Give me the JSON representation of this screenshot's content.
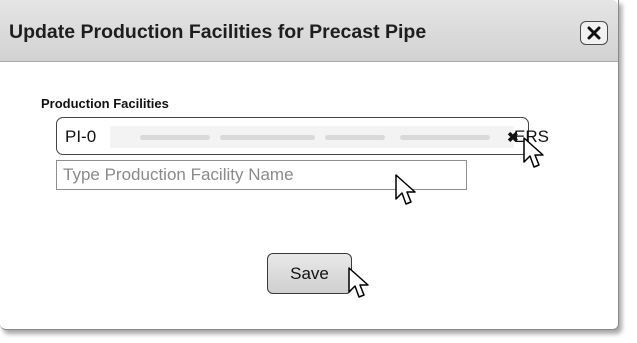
{
  "dialog": {
    "title": "Update Production Facilities for Precast Pipe",
    "close_icon": "close-icon"
  },
  "production_facilities": {
    "label": "Production Facilities",
    "selected_token": {
      "prefix": "PI-0",
      "suffix": "ERS",
      "remove_glyph": "✖",
      "redacted": true
    },
    "search_placeholder": "Type Production Facility Name",
    "search_value": ""
  },
  "actions": {
    "save_label": "Save"
  },
  "cursors": [
    "pointer-cursor",
    "pointer-cursor",
    "pointer-cursor"
  ]
}
